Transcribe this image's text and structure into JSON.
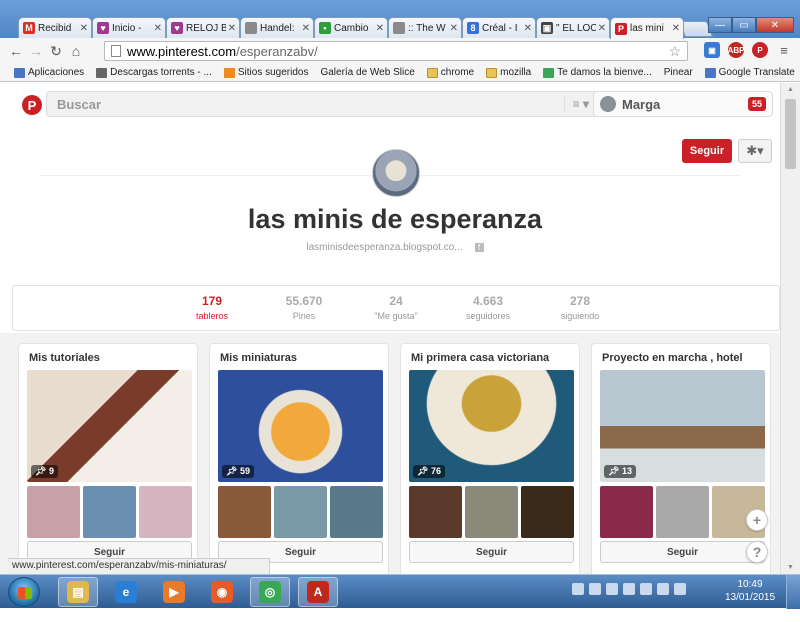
{
  "browser": {
    "tabs": [
      {
        "title": "Recibid",
        "favicon": "gmail-icon",
        "color": "#d93025",
        "glyph": "M"
      },
      {
        "title": "Inicio -",
        "favicon": "blog-icon",
        "color": "#a03a8c",
        "glyph": "♥"
      },
      {
        "title": "RELOJ B",
        "favicon": "blog-icon",
        "color": "#a03a8c",
        "glyph": "♥"
      },
      {
        "title": "Handel:",
        "favicon": "page-icon",
        "color": "#8a8a8a",
        "glyph": ""
      },
      {
        "title": "Cambio",
        "favicon": "dots-icon",
        "color": "#2e9e3a",
        "glyph": "•"
      },
      {
        "title": ":: The W",
        "favicon": "page-icon",
        "color": "#8a8a8a",
        "glyph": ""
      },
      {
        "title": "Créal - I",
        "favicon": "google-plus-icon",
        "color": "#3b6fd8",
        "glyph": "8"
      },
      {
        "title": "\" EL LOC",
        "favicon": "monitor-icon",
        "color": "#444",
        "glyph": "▣"
      },
      {
        "title": "las mini",
        "favicon": "pinterest-icon",
        "color": "#cb2027",
        "glyph": "P"
      }
    ],
    "url_host": "www.pinterest.com",
    "url_path": "/esperanzabv/",
    "bookmarks": [
      {
        "label": "Aplicaciones",
        "icon": "apps-grid-icon"
      },
      {
        "label": "Descargas torrents - ...",
        "icon": "wifi-icon"
      },
      {
        "label": "Sitios sugeridos",
        "icon": "bookmark-orange-icon"
      },
      {
        "label": "Galería de Web Slice",
        "icon": "page-icon"
      },
      {
        "label": "chrome",
        "icon": "folder-icon"
      },
      {
        "label": "mozilla",
        "icon": "folder-icon"
      },
      {
        "label": "Te damos la bienve...",
        "icon": "chrome-icon"
      },
      {
        "label": "Pinear",
        "icon": "page-icon"
      },
      {
        "label": "Google Translate",
        "icon": "translate-icon"
      }
    ],
    "bookmarks_more": "»",
    "status_url": "www.pinterest.com/esperanzabv/mis-miniaturas/"
  },
  "pinterest": {
    "search_placeholder": "Buscar",
    "user_name": "Marga",
    "notifications": "55",
    "follow_label": "Seguir",
    "profile_name": "las minis de esperanza",
    "profile_site": "lasminisdeesperanza.blogspot.co...",
    "stats": [
      {
        "value": "179",
        "label": "tableros",
        "active": true
      },
      {
        "value": "55.670",
        "label": "Pines",
        "active": false
      },
      {
        "value": "24",
        "label": "\"Me gusta\"",
        "active": false
      },
      {
        "value": "4.663",
        "label": "seguidores",
        "active": false
      },
      {
        "value": "278",
        "label": "siguiendo",
        "active": false
      }
    ],
    "boards": [
      {
        "title": "Mis tutoriales",
        "pins": "9",
        "follow": "Seguir",
        "cover": "linear-gradient(135deg,#e9ddd0 0 40%,#7a3b2a 40% 55%,#f3efe8 55%)",
        "thumbs": [
          "#caa0a8",
          "#6a8fb0",
          "#d7b5c0"
        ]
      },
      {
        "title": "Mis miniaturas",
        "pins": "59",
        "follow": "Seguir",
        "cover": "radial-gradient(circle at 50% 55%,#f0a93a 0 28%,#e9e2d6 29% 40%,#2e4f9c 41%)",
        "thumbs": [
          "#8a5a3a",
          "#7a9aa8",
          "#5a7a8c"
        ]
      },
      {
        "title": "Mi primera casa victoriana",
        "pins": "76",
        "follow": "Seguir",
        "cover": "radial-gradient(ellipse at 50% 30%,#c9a23a 0 25%,#efe8d8 26% 55%,#1f5a7a 56%)",
        "thumbs": [
          "#5a3a2a",
          "#8a8a7a",
          "#3a2a1a"
        ]
      },
      {
        "title": "Proyecto en marcha , hotel",
        "pins": "13",
        "follow": "Seguir",
        "cover": "linear-gradient(180deg,#b9c8d0 0 50%,#8a6a4a 50% 70%,#d8dde0 70%)",
        "thumbs": [
          "#8a2a4a",
          "#a8a8a8",
          "#c8b89a"
        ]
      }
    ]
  },
  "taskbar": {
    "time": "10:49",
    "date": "13/01/2015",
    "apps": [
      {
        "name": "file-explorer-icon",
        "color": "#e0b850",
        "glyph": "▤",
        "active": true
      },
      {
        "name": "internet-explorer-icon",
        "color": "#2a7fd4",
        "glyph": "e",
        "active": false
      },
      {
        "name": "media-player-icon",
        "color": "#e87a2a",
        "glyph": "▶",
        "active": false
      },
      {
        "name": "firefox-icon",
        "color": "#e55b2a",
        "glyph": "◉",
        "active": false
      },
      {
        "name": "chrome-icon",
        "color": "#3aa757",
        "glyph": "◎",
        "active": true
      },
      {
        "name": "acrobat-icon",
        "color": "#c0281e",
        "glyph": "A",
        "active": true
      }
    ]
  }
}
